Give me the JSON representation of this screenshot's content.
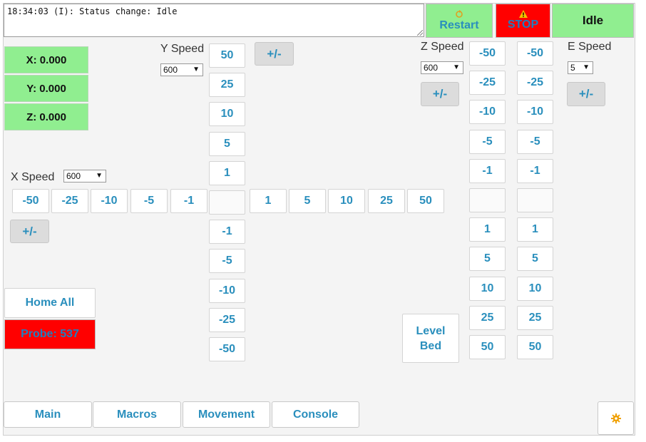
{
  "console": {
    "text": "18:34:03 (I): Status change: Idle"
  },
  "buttons": {
    "restart": "Restart",
    "stop": "STOP",
    "idle": "Idle",
    "home_all": "Home All",
    "level_bed": "Level\nBed",
    "plus_minus": "+/-"
  },
  "positions": {
    "x": "X: 0.000",
    "y": "Y: 0.000",
    "z": "Z: 0.000"
  },
  "probe": "Probe: 537",
  "speeds": {
    "x": {
      "label": "X Speed",
      "value": "600"
    },
    "y": {
      "label": "Y Speed",
      "value": "600"
    },
    "z": {
      "label": "Z Speed",
      "value": "600"
    },
    "e": {
      "label": "E Speed",
      "value": "5"
    }
  },
  "x_neg": [
    "-50",
    "-25",
    "-10",
    "-5",
    "-1"
  ],
  "x_pos": [
    "1",
    "5",
    "10",
    "25",
    "50"
  ],
  "y_up": [
    "50",
    "25",
    "10",
    "5",
    "1"
  ],
  "y_down": [
    "-1",
    "-5",
    "-10",
    "-25",
    "-50"
  ],
  "z_up": [
    "-50",
    "-25",
    "-10",
    "-5",
    "-1"
  ],
  "z_down": [
    "1",
    "5",
    "10",
    "25",
    "50"
  ],
  "e_up": [
    "-50",
    "-25",
    "-10",
    "-5",
    "-1"
  ],
  "e_down": [
    "1",
    "5",
    "10",
    "25",
    "50"
  ],
  "tabs": [
    "Main",
    "Macros",
    "Movement",
    "Console"
  ],
  "icons": {
    "restart": "restart-icon",
    "warning": "warning-icon",
    "settings": "gear-icon"
  },
  "colors": {
    "green": "#90ee90",
    "red": "#ff0000",
    "accent": "#2a8fbd"
  }
}
